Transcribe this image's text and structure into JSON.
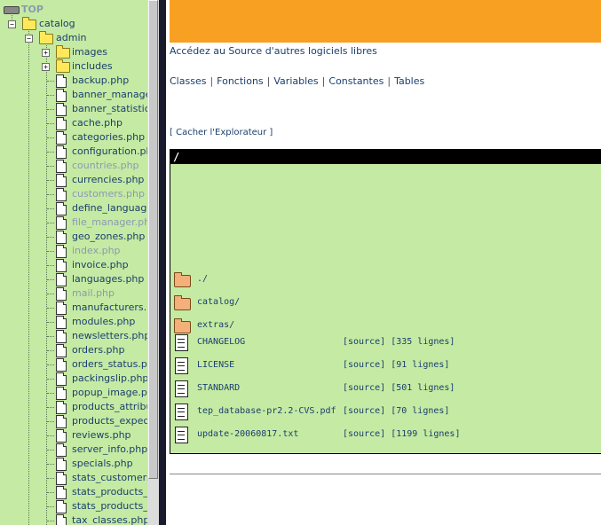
{
  "tree": {
    "root_label": "TOP",
    "catalog_label": "catalog",
    "admin_label": "admin",
    "folders": [
      "images",
      "includes"
    ],
    "files": [
      {
        "name": "backup.php",
        "dim": false
      },
      {
        "name": "banner_manager",
        "dim": false
      },
      {
        "name": "banner_statistics",
        "dim": false
      },
      {
        "name": "cache.php",
        "dim": false
      },
      {
        "name": "categories.php",
        "dim": false
      },
      {
        "name": "configuration.php",
        "dim": false
      },
      {
        "name": "countries.php",
        "dim": true
      },
      {
        "name": "currencies.php",
        "dim": false
      },
      {
        "name": "customers.php",
        "dim": true
      },
      {
        "name": "define_language.",
        "dim": false
      },
      {
        "name": "file_manager.php",
        "dim": true
      },
      {
        "name": "geo_zones.php",
        "dim": false
      },
      {
        "name": "index.php",
        "dim": true
      },
      {
        "name": "invoice.php",
        "dim": false
      },
      {
        "name": "languages.php",
        "dim": false
      },
      {
        "name": "mail.php",
        "dim": true
      },
      {
        "name": "manufacturers.pl",
        "dim": false
      },
      {
        "name": "modules.php",
        "dim": false
      },
      {
        "name": "newsletters.php",
        "dim": false
      },
      {
        "name": "orders.php",
        "dim": false
      },
      {
        "name": "orders_status.ph",
        "dim": false
      },
      {
        "name": "packingslip.php",
        "dim": false
      },
      {
        "name": "popup_image.ph",
        "dim": false
      },
      {
        "name": "products_attribut",
        "dim": false
      },
      {
        "name": "products_expecte",
        "dim": false
      },
      {
        "name": "reviews.php",
        "dim": false
      },
      {
        "name": "server_info.php",
        "dim": false
      },
      {
        "name": "specials.php",
        "dim": false
      },
      {
        "name": "stats_customers.",
        "dim": false
      },
      {
        "name": "stats_products_p",
        "dim": false
      },
      {
        "name": "stats_products_v",
        "dim": false
      },
      {
        "name": "tax_classes.php",
        "dim": false
      }
    ]
  },
  "header": {
    "source_link": "Accédez au Source d'autres logiciels libres",
    "nav": [
      "Classes",
      "Fonctions",
      "Variables",
      "Constantes",
      "Tables"
    ],
    "explorer_toggle": "[ Cacher l'Explorateur ]"
  },
  "browser": {
    "path": "/",
    "dirs": [
      "./",
      "catalog/",
      "extras/"
    ],
    "files": [
      {
        "name": "CHANGELOG",
        "source": "[source]",
        "lines": "[335 lignes]"
      },
      {
        "name": "LICENSE",
        "source": "[source]",
        "lines": "[91 lignes]"
      },
      {
        "name": "STANDARD",
        "source": "[source]",
        "lines": "[501 lignes]"
      },
      {
        "name": "tep_database-pr2.2-CVS.pdf",
        "source": "[source]",
        "lines": "[70 lignes]"
      },
      {
        "name": "update-20060817.txt",
        "source": "[source]",
        "lines": "[1199 lignes]"
      }
    ]
  },
  "colors": {
    "tree_bg": "#c5eaa3",
    "header_bar": "#f8a021",
    "link": "#1a3f6e",
    "path_bar": "#000000"
  }
}
